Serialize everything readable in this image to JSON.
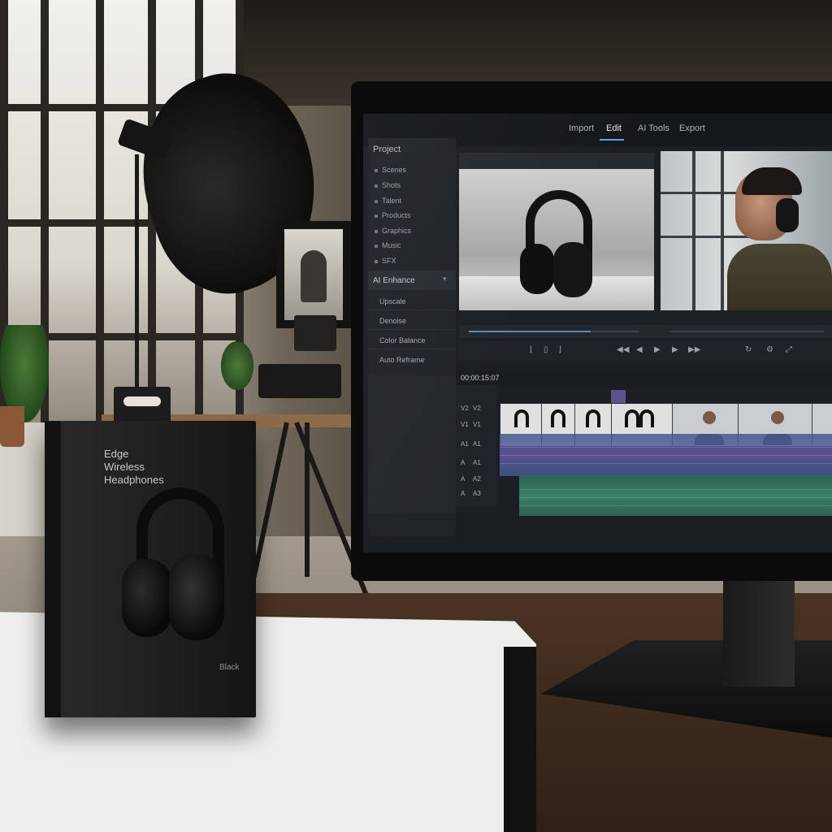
{
  "product_box": {
    "title": "Edge\nWireless\nHeadphones",
    "variant": "Black"
  },
  "editor": {
    "nav": [
      "Import",
      "Edit",
      "AI Tools",
      "Export"
    ],
    "active_nav": "Edit",
    "project_title": "Project",
    "library_items": [
      "Scenes",
      "Shots",
      "Talent",
      "Products",
      "Graphics",
      "Music",
      "SFX"
    ],
    "enhance": {
      "title": "AI Enhance",
      "items": [
        "Upscale",
        "Denoise",
        "Color Balance",
        "Auto Reframe"
      ]
    },
    "timeline": {
      "timecode": "00:00:15:07",
      "tracks": [
        {
          "left": "V2",
          "right": "V2"
        },
        {
          "left": "V1",
          "right": "V1"
        },
        {
          "left": "A1",
          "right": "A1"
        },
        {
          "left": "A",
          "right": "A1"
        },
        {
          "left": "A",
          "right": "A2"
        },
        {
          "left": "A",
          "right": "A3"
        }
      ]
    }
  },
  "colors": {
    "accent": "#5aa3e6",
    "audio_track_1": "#6a5aa8",
    "audio_track_2": "#3e8a6e",
    "panel_bg": "#1b1e22"
  },
  "icons": {
    "play": "play-icon",
    "step_back": "step-back-icon",
    "step_forward": "step-forward-icon",
    "chevron": "chevron-down-icon"
  }
}
